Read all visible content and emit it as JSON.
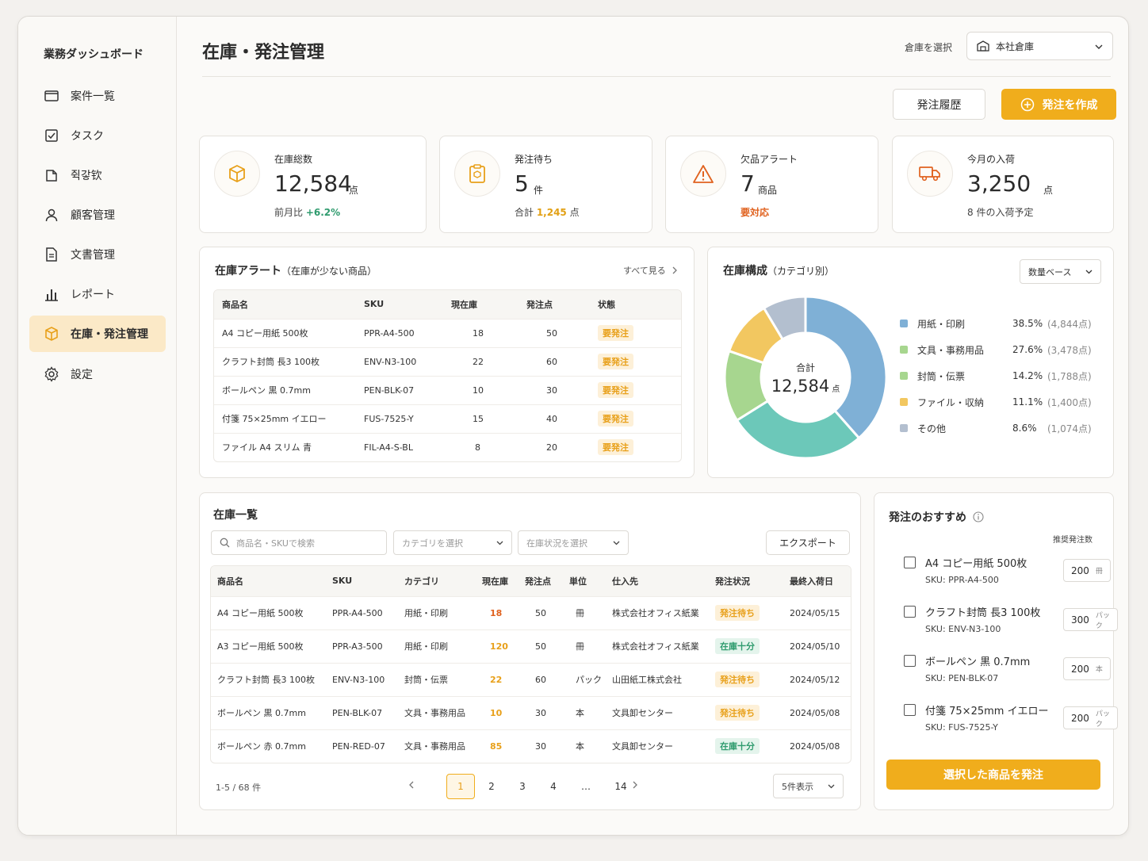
{
  "sidebar": {
    "brand": "業務ダッシュボード",
    "items": [
      {
        "label": "案件一覧",
        "icon": "folder-icon"
      },
      {
        "label": "タスク",
        "icon": "checklist-icon"
      },
      {
        "label": "쥑갛钦",
        "icon": "note-icon"
      },
      {
        "label": "顧客管理",
        "icon": "user-icon"
      },
      {
        "label": "文書管理",
        "icon": "document-icon"
      },
      {
        "label": "レポート",
        "icon": "bar-chart-icon"
      },
      {
        "label": "在庫・発注管理",
        "icon": "box-icon"
      },
      {
        "label": "設定",
        "icon": "gear-icon"
      }
    ]
  },
  "header": {
    "title": "在庫・発注管理",
    "warehouse_label": "倉庫を選択",
    "warehouse_value": "本社倉庫",
    "history_button": "発注履歴",
    "create_button": "発注を作成"
  },
  "kpis": [
    {
      "label": "在庫総数",
      "value": "12,584",
      "unit": "点",
      "sub_prefix": "前月比 ",
      "sub_value": "+6.2%",
      "sub_suffix": "",
      "icon": "box-icon"
    },
    {
      "label": "発注待ち",
      "value": "5",
      "unit": "件",
      "sub_prefix": "合計 ",
      "sub_value": "1,245",
      "sub_suffix": " 点",
      "icon": "clipboard-icon"
    },
    {
      "label": "欠品アラート",
      "value": "7",
      "unit": "商品",
      "sub_prefix": "",
      "sub_value": "要対応",
      "sub_suffix": "",
      "icon": "warning-icon"
    },
    {
      "label": "今月の入荷",
      "value": "3,250",
      "unit": "点",
      "sub_prefix": "",
      "sub_value": "",
      "sub_suffix": "8 件の入荷予定",
      "icon": "truck-icon"
    }
  ],
  "alerts": {
    "title": "在庫アラート",
    "subtitle": "（在庫が少ない商品）",
    "see_all": "すべて見る",
    "columns": [
      "商品名",
      "SKU",
      "現在庫",
      "発注点",
      "状態"
    ],
    "rows": [
      {
        "name": "A4 コピー用紙 500枚",
        "sku": "PPR-A4-500",
        "stock": "18",
        "reorder": "50",
        "status": "要発注"
      },
      {
        "name": "クラフト封筒 長3 100枚",
        "sku": "ENV-N3-100",
        "stock": "22",
        "reorder": "60",
        "status": "要発注"
      },
      {
        "name": "ボールペン 黒 0.7mm",
        "sku": "PEN-BLK-07",
        "stock": "10",
        "reorder": "30",
        "status": "要発注"
      },
      {
        "name": "付箋 75×25mm イエロー",
        "sku": "FUS-7525-Y",
        "stock": "15",
        "reorder": "40",
        "status": "要発注"
      },
      {
        "name": "ファイル A4 スリム 青",
        "sku": "FIL-A4-S-BL",
        "stock": "8",
        "reorder": "20",
        "status": "要発注"
      }
    ]
  },
  "composition": {
    "title": "在庫構成",
    "subtitle": "（カテゴリ別）",
    "basis_select": "数量ベース",
    "center_label": "合計",
    "center_value": "12,584",
    "center_unit": "点"
  },
  "chart_data": {
    "type": "pie",
    "categories": [
      "用紙・印刷",
      "文具・事務用品",
      "封筒・伝票",
      "ファイル・収納",
      "その他"
    ],
    "values": [
      38.5,
      27.6,
      14.2,
      11.1,
      8.6
    ],
    "percent_labels": [
      "38.5%",
      "27.6%",
      "14.2%",
      "11.1%",
      "8.6%"
    ],
    "count_labels": [
      "(4,844点)",
      "(3,478点)",
      "(1,788点)",
      "(1,400点)",
      "(1,074点)"
    ],
    "colors": [
      "#7fb0d6",
      "#6cc8b9",
      "#a7d68f",
      "#f2c760",
      "#b3bfcf"
    ],
    "legend_colors": [
      "#7fb0d6",
      "#a7d68f",
      "#a7d68f",
      "#f2c760",
      "#b3bfcf"
    ]
  },
  "inventory": {
    "title": "在庫一覧",
    "search_placeholder": "商品名・SKUで検索",
    "category_select": "カテゴリを選択",
    "status_select": "在庫状況を選択",
    "export_button": "エクスポート",
    "columns": [
      "商品名",
      "SKU",
      "カテゴリ",
      "現在庫",
      "発注点",
      "単位",
      "仕入先",
      "発注状況",
      "最終入荷日"
    ],
    "rows": [
      {
        "name": "A4 コピー用紙 500枚",
        "sku": "PPR-A4-500",
        "category": "用紙・印刷",
        "stock": "18",
        "reorder": "50",
        "unit": "冊",
        "supplier": "株式会社オフィス紙業",
        "status": "発注待ち",
        "date": "2024/05/15"
      },
      {
        "name": "A3 コピー用紙 500枚",
        "sku": "PPR-A3-500",
        "category": "用紙・印刷",
        "stock": "120",
        "reorder": "50",
        "unit": "冊",
        "supplier": "株式会社オフィス紙業",
        "status": "在庫十分",
        "date": "2024/05/10"
      },
      {
        "name": "クラフト封筒 長3 100枚",
        "sku": "ENV-N3-100",
        "category": "封筒・伝票",
        "stock": "22",
        "reorder": "60",
        "unit": "パック",
        "supplier": "山田紙工株式会社",
        "status": "発注待ち",
        "date": "2024/05/12"
      },
      {
        "name": "ボールペン 黒 0.7mm",
        "sku": "PEN-BLK-07",
        "category": "文具・事務用品",
        "stock": "10",
        "reorder": "30",
        "unit": "本",
        "supplier": "文具卸センター",
        "status": "発注待ち",
        "date": "2024/05/08"
      },
      {
        "name": "ボールペン 赤 0.7mm",
        "sku": "PEN-RED-07",
        "category": "文具・事務用品",
        "stock": "85",
        "reorder": "30",
        "unit": "本",
        "supplier": "文具卸センター",
        "status": "在庫十分",
        "date": "2024/05/08"
      }
    ],
    "range_label": "1-5 / 68 件",
    "pages": [
      "1",
      "2",
      "3",
      "4",
      "…",
      "14"
    ],
    "page_size": "5件表示"
  },
  "recommend": {
    "title": "発注のおすすめ",
    "qty_header": "推奨発注数",
    "items": [
      {
        "name": "A4 コピー用紙 500枚",
        "sku": "SKU: PPR-A4-500",
        "qty": "200",
        "unit": "冊"
      },
      {
        "name": "クラフト封筒 長3 100枚",
        "sku": "SKU: ENV-N3-100",
        "qty": "300",
        "unit": "パック"
      },
      {
        "name": "ボールペン 黒 0.7mm",
        "sku": "SKU: PEN-BLK-07",
        "qty": "200",
        "unit": "本"
      },
      {
        "name": "付箋 75×25mm イエロー",
        "sku": "SKU: FUS-7525-Y",
        "qty": "200",
        "unit": "パック"
      }
    ],
    "submit_button": "選択した商品を発注"
  }
}
